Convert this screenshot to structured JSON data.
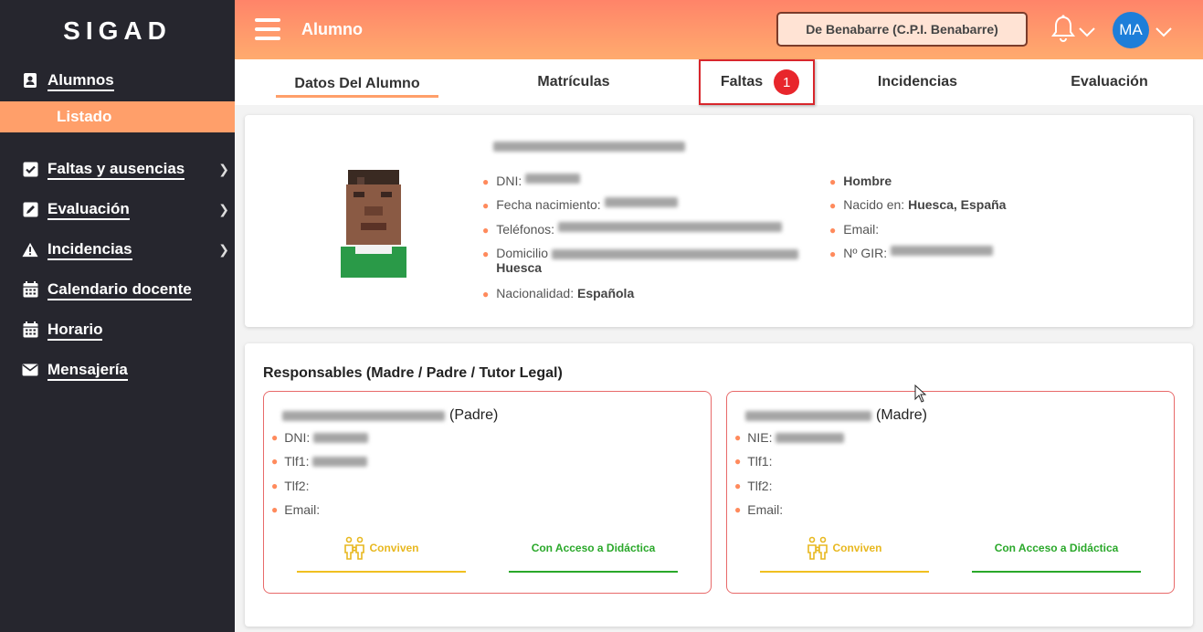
{
  "sidebar": {
    "brand": "SIGAD",
    "items": [
      {
        "label": "Alumnos",
        "icon": "student-card-icon",
        "chevron": false
      },
      {
        "label": "Faltas y ausencias",
        "icon": "checkbox-icon",
        "chevron": true
      },
      {
        "label": "Evaluación",
        "icon": "edit-icon",
        "chevron": true
      },
      {
        "label": "Incidencias",
        "icon": "warning-icon",
        "chevron": true
      },
      {
        "label": "Calendario docente",
        "icon": "calendar-icon",
        "chevron": false
      },
      {
        "label": "Horario",
        "icon": "schedule-icon",
        "chevron": false
      },
      {
        "label": "Mensajería",
        "icon": "envelope-icon",
        "chevron": false
      }
    ],
    "sub_item": "Listado"
  },
  "header": {
    "title": "Alumno",
    "school": "De Benabarre (C.P.I. Benabarre)",
    "avatar_initials": "MA"
  },
  "tabs": [
    {
      "label": "Datos Del Alumno",
      "active": true
    },
    {
      "label": "Matrículas"
    },
    {
      "label": "Faltas",
      "badge": "1"
    },
    {
      "label": "Incidencias"
    },
    {
      "label": "Evaluación"
    }
  ],
  "student": {
    "dni_label": "DNI:",
    "birth_label": "Fecha nacimiento:",
    "phones_label": "Teléfonos:",
    "address_label": "Domicilio",
    "address_city": "Huesca",
    "nationality_label": "Nacionalidad:",
    "nationality": "Española",
    "gender": "Hombre",
    "born_label": "Nacido en:",
    "born_in": "Huesca, España",
    "email_label": "Email:",
    "gir_label": "Nº GIR:"
  },
  "responsables": {
    "title": "Responsables (Madre / Padre / Tutor Legal)",
    "items": [
      {
        "relation": "(Padre)",
        "id_label": "DNI:",
        "tlf1": "Tlf1:",
        "tlf2": "Tlf2:",
        "email": "Email:",
        "conviven": "Conviven",
        "acceso": "Con Acceso a Didáctica"
      },
      {
        "relation": "(Madre)",
        "id_label": "NIE:",
        "tlf1": "Tlf1:",
        "tlf2": "Tlf2:",
        "email": "Email:",
        "conviven": "Conviven",
        "acceso": "Con Acceso a Didáctica"
      }
    ]
  },
  "colors": {
    "accent": "#ff9f6a",
    "sidebar_bg": "#26262e",
    "header_top": "#ff8469",
    "badge_red": "#e8262c"
  }
}
